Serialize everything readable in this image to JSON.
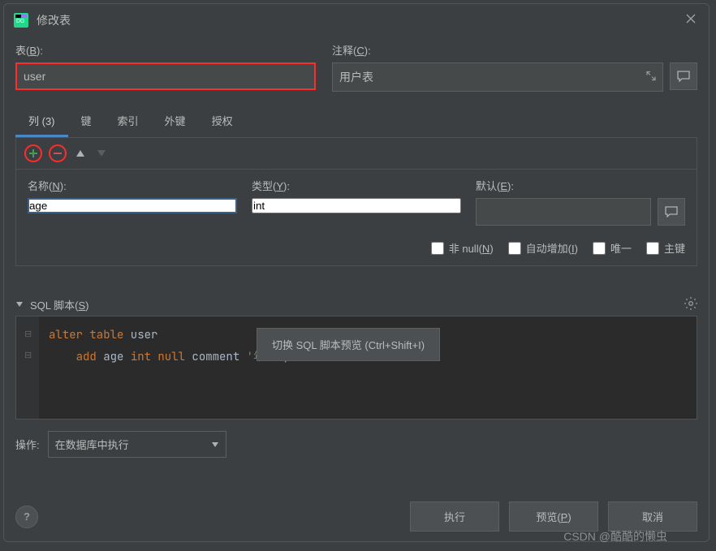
{
  "window": {
    "title": "修改表"
  },
  "labels": {
    "table": "表(B):",
    "comment": "注释(C):",
    "name": "名称(N):",
    "type": "类型(Y):",
    "default": "默认(E):",
    "notnull": "非 null(N)",
    "autoinc": "自动增加(I)",
    "unique": "唯一",
    "primary": "主键",
    "sqlScript": "SQL 脚本(S)",
    "action": "操作:"
  },
  "values": {
    "table": "user",
    "comment": "用户表",
    "colName": "age",
    "colType": "int",
    "colDefault": "",
    "actionSelected": "在数据库中执行"
  },
  "tabs": [
    {
      "label": "列 (3)",
      "active": true
    },
    {
      "label": "键",
      "active": false
    },
    {
      "label": "索引",
      "active": false
    },
    {
      "label": "外键",
      "active": false
    },
    {
      "label": "授权",
      "active": false
    }
  ],
  "tooltip": "切换 SQL 脚本预览 (Ctrl+Shift+I)",
  "sql": {
    "line1_pre": "alter table",
    "line1_id": " user",
    "line2_pre": "    add ",
    "line2_name": "age ",
    "line2_type": "int null",
    "line2_mid": " comment ",
    "line2_str": "'年龄'",
    "line2_end": ";"
  },
  "buttons": {
    "execute": "执行",
    "preview": "预览(P)",
    "cancel": "取消"
  },
  "watermark": "CSDN @酷酷的懒虫"
}
